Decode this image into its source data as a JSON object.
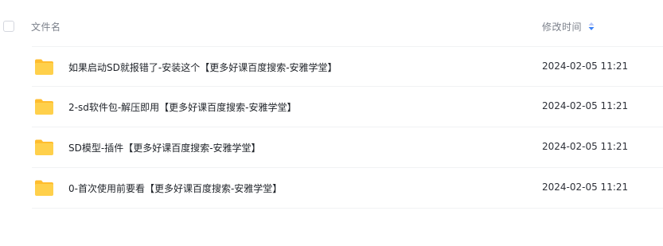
{
  "header": {
    "col_name": "文件名",
    "col_time": "修改时间",
    "sort_icon": "sort-arrows-icon"
  },
  "files": [
    {
      "icon": "folder-icon",
      "name": "如果启动SD就报错了-安装这个【更多好课百度搜索-安雅学堂】",
      "modified": "2024-02-05 11:21"
    },
    {
      "icon": "folder-icon",
      "name": "2-sd软件包-解压即用【更多好课百度搜索-安雅学堂】",
      "modified": "2024-02-05 11:21"
    },
    {
      "icon": "folder-icon",
      "name": "SD模型-插件【更多好课百度搜索-安雅学堂】",
      "modified": "2024-02-05 11:21"
    },
    {
      "icon": "folder-icon",
      "name": "0-首次使用前要看【更多好课百度搜索-安雅学堂】",
      "modified": "2024-02-05 11:21"
    }
  ],
  "colors": {
    "folder_body": "#ffd04b",
    "folder_tab": "#ffbd2e",
    "sort_active": "#3b82f6",
    "sort_inactive": "#b7c7f7"
  }
}
